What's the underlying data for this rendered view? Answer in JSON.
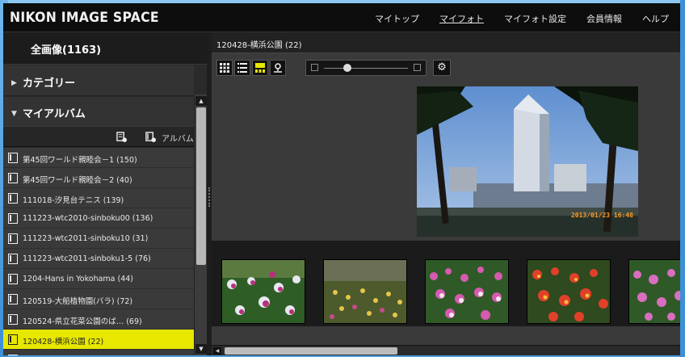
{
  "header": {
    "logo": "NIKON IMAGE SPACE",
    "nav": [
      "マイトップ",
      "マイフォト",
      "マイフォト設定",
      "会員情報",
      "ヘルプ"
    ],
    "active_nav": "マイフォト"
  },
  "sidebar": {
    "all_images": "全画像(1163)",
    "category": "カテゴリー",
    "my_album": "マイアルバム",
    "album_button_label": "アルバム",
    "albums": [
      "第45回ワールド親睦会－1 (150)",
      "第45回ワールド親睦会－2 (40)",
      "111018-汐見台テニス (139)",
      "111223-wtc2010-sinboku00 (136)",
      "111223-wtc2011-sinboku10 (31)",
      "111223-wtc2011-sinboku1-5 (76)",
      "1204-Hans in Yokohama (44)",
      "120519-大船植物園(バラ) (72)",
      "120524-県立花菜公園のば… (69)",
      "120428-横浜公園 (22)"
    ],
    "selected_album": "120428-横浜公園 (22)"
  },
  "main": {
    "breadcrumb": "120428-横浜公園 (22)",
    "photo_timestamp": "2013/01/23 16:48",
    "zoom_level": 0.28,
    "scroll_position": 0.0
  },
  "colors": {
    "selected_album": "#e7e700",
    "background": "#3a3a3a",
    "accent_blue": "#4a9fe0"
  },
  "icons": [
    "grid-view-icon",
    "list-view-icon",
    "film-view-icon",
    "map-view-icon",
    "settings-gear-icon",
    "new-category-icon",
    "new-album-icon",
    "album-icon"
  ]
}
